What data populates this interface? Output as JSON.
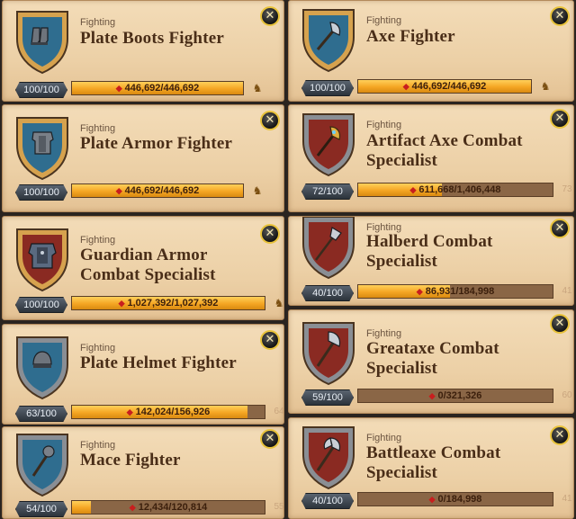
{
  "colors": {
    "shield_blue": "#2f6d8f",
    "shield_red": "#8a2a22",
    "rim_gold": "#d6a24e",
    "rim_silver": "#8a8e94",
    "bar_fill": "#f5a623",
    "title": "#4a2e18"
  },
  "close_label": "✕",
  "cards": [
    {
      "category": "Fighting",
      "title_lines": [
        "Plate Boots Fighter"
      ],
      "level": "100/100",
      "xp": "446,692/446,692",
      "badge": "",
      "progress": 1.0,
      "shield": "blue",
      "rim": "gold",
      "icon": "plate-boots-icon"
    },
    {
      "category": "Fighting",
      "title_lines": [
        "Axe Fighter"
      ],
      "level": "100/100",
      "xp": "446,692/446,692",
      "badge": "",
      "progress": 1.0,
      "shield": "blue",
      "rim": "gold",
      "icon": "axe-icon"
    },
    {
      "category": "Fighting",
      "title_lines": [
        "Plate Armor Fighter"
      ],
      "level": "100/100",
      "xp": "446,692/446,692",
      "badge": "",
      "progress": 1.0,
      "shield": "blue",
      "rim": "gold",
      "icon": "plate-armor-icon"
    },
    {
      "category": "Fighting",
      "title_lines": [
        "Artifact Axe Combat",
        "Specialist"
      ],
      "level": "72/100",
      "xp": "611,668/1,406,448",
      "badge": "73",
      "progress": 0.43,
      "shield": "red",
      "rim": "silver",
      "icon": "artifact-axe-icon"
    },
    {
      "category": "Fighting",
      "title_lines": [
        "Guardian Armor",
        "Combat Specialist"
      ],
      "level": "100/100",
      "xp": "1,027,392/1,027,392",
      "badge": "",
      "progress": 1.0,
      "shield": "red",
      "rim": "gold",
      "icon": "guardian-armor-icon"
    },
    {
      "category": "Fighting",
      "title_lines": [
        "Halberd Combat",
        "Specialist"
      ],
      "level": "40/100",
      "xp": "86,931/184,998",
      "badge": "41",
      "progress": 0.47,
      "shield": "red",
      "rim": "silver",
      "icon": "halberd-icon"
    },
    {
      "category": "Fighting",
      "title_lines": [
        "Plate Helmet Fighter"
      ],
      "level": "63/100",
      "xp": "142,024/156,926",
      "badge": "64",
      "progress": 0.91,
      "shield": "blue",
      "rim": "silver",
      "icon": "plate-helmet-icon"
    },
    {
      "category": "Fighting",
      "title_lines": [
        "Greataxe Combat",
        "Specialist"
      ],
      "level": "59/100",
      "xp": "0/321,326",
      "badge": "60",
      "progress": 0.0,
      "shield": "red",
      "rim": "silver",
      "icon": "greataxe-icon"
    },
    {
      "category": "Fighting",
      "title_lines": [
        "Mace Fighter"
      ],
      "level": "54/100",
      "xp": "12,434/120,814",
      "badge": "55",
      "progress": 0.1,
      "shield": "blue",
      "rim": "silver",
      "icon": "mace-icon"
    },
    {
      "category": "Fighting",
      "title_lines": [
        "Battleaxe Combat",
        "Specialist"
      ],
      "level": "40/100",
      "xp": "0/184,998",
      "badge": "41",
      "progress": 0.0,
      "shield": "red",
      "rim": "silver",
      "icon": "battleaxe-icon"
    }
  ]
}
